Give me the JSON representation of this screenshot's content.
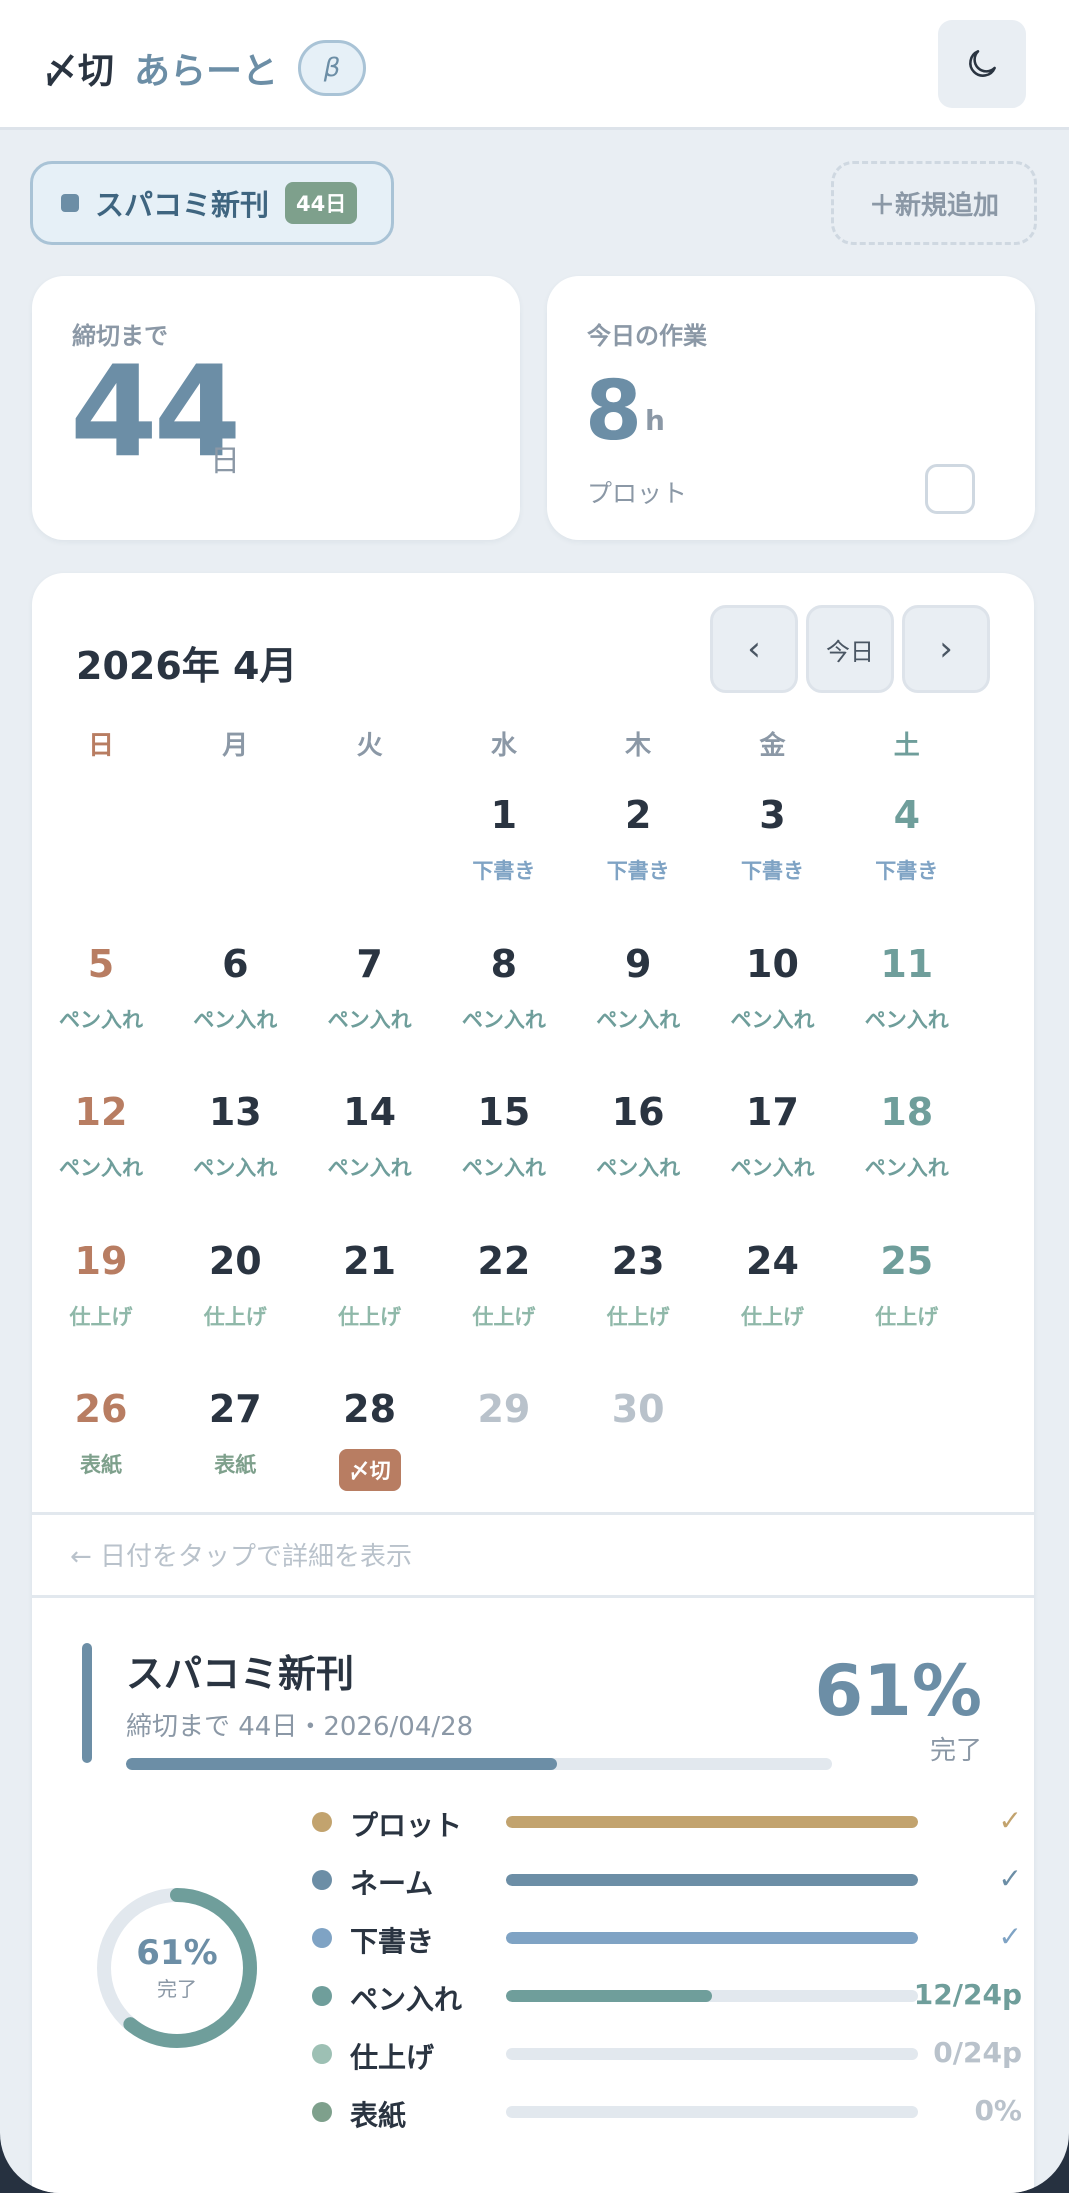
{
  "app": {
    "logo_mark": "〆切",
    "logo_text": "あらーと",
    "beta_label": "β"
  },
  "project_chip": {
    "name": "スパコミ新刊",
    "badge": "44日",
    "color": "#6c8ea6"
  },
  "add_button_label": "＋新規追加",
  "stats": {
    "deadline_label": "締切まで",
    "deadline_value": "44",
    "deadline_unit": "日",
    "work_label": "今日の作業",
    "work_value": "8",
    "work_unit": "h",
    "work_task": "プロット"
  },
  "calendar": {
    "title": "2026年 4月",
    "prev_label": "‹",
    "today_label": "今日",
    "next_label": "›",
    "weekdays": [
      "日",
      "月",
      "火",
      "水",
      "木",
      "金",
      "土"
    ],
    "days": [
      {
        "n": "1",
        "task": "下書き"
      },
      {
        "n": "2",
        "task": "下書き"
      },
      {
        "n": "3",
        "task": "下書き"
      },
      {
        "n": "4",
        "task": "下書き"
      },
      {
        "n": "5",
        "task": "ペン入れ"
      },
      {
        "n": "6",
        "task": "ペン入れ"
      },
      {
        "n": "7",
        "task": "ペン入れ"
      },
      {
        "n": "8",
        "task": "ペン入れ"
      },
      {
        "n": "9",
        "task": "ペン入れ"
      },
      {
        "n": "10",
        "task": "ペン入れ"
      },
      {
        "n": "11",
        "task": "ペン入れ"
      },
      {
        "n": "12",
        "task": "ペン入れ"
      },
      {
        "n": "13",
        "task": "ペン入れ"
      },
      {
        "n": "14",
        "task": "ペン入れ"
      },
      {
        "n": "15",
        "task": "ペン入れ"
      },
      {
        "n": "16",
        "task": "ペン入れ"
      },
      {
        "n": "17",
        "task": "ペン入れ"
      },
      {
        "n": "18",
        "task": "ペン入れ"
      },
      {
        "n": "19",
        "task": "仕上げ"
      },
      {
        "n": "20",
        "task": "仕上げ"
      },
      {
        "n": "21",
        "task": "仕上げ"
      },
      {
        "n": "22",
        "task": "仕上げ"
      },
      {
        "n": "23",
        "task": "仕上げ"
      },
      {
        "n": "24",
        "task": "仕上げ"
      },
      {
        "n": "25",
        "task": "仕上げ"
      },
      {
        "n": "26",
        "task": "表紙"
      },
      {
        "n": "27",
        "task": "表紙"
      },
      {
        "n": "28",
        "task": "〆切",
        "deadline": true
      },
      {
        "n": "29",
        "task": "",
        "past_deadline": true
      },
      {
        "n": "30",
        "task": "",
        "past_deadline": true
      }
    ],
    "first_weekday_index": 3,
    "colors": {
      "sunday": "#b87d62",
      "saturday": "#6f9e9b",
      "weekday": "#2a3441",
      "disabled": "#b9c2cb",
      "task_shitagaki": "#7fa3c4",
      "task_penire": "#6f9e9b",
      "task_shiage": "#8fb8a9",
      "task_hyoshi": "#7ea08c"
    }
  },
  "hint_text": "← 日付をタップで詳細を表示",
  "detail": {
    "title": "スパコミ新刊",
    "subtitle": "締切まで 44日・2026/04/28",
    "percent_text": "61%",
    "percent_label": "完了",
    "progress": 0.61,
    "donut_percent_text": "61%",
    "donut_label": "完了",
    "stages": [
      {
        "name": "プロット",
        "color": "#c2a36e",
        "progress": 1.0,
        "status": "✓"
      },
      {
        "name": "ネーム",
        "color": "#6c8ea6",
        "progress": 1.0,
        "status": "✓"
      },
      {
        "name": "下書き",
        "color": "#7fa3c4",
        "progress": 1.0,
        "status": "✓"
      },
      {
        "name": "ペン入れ",
        "color": "#6f9e9b",
        "progress": 0.5,
        "status": "12/24p"
      },
      {
        "name": "仕上げ",
        "color": "#9dc0b4",
        "progress": 0.0,
        "status": "0/24p"
      },
      {
        "name": "表紙",
        "color": "#7ea08c",
        "progress": 0.0,
        "status": "0%"
      }
    ]
  }
}
